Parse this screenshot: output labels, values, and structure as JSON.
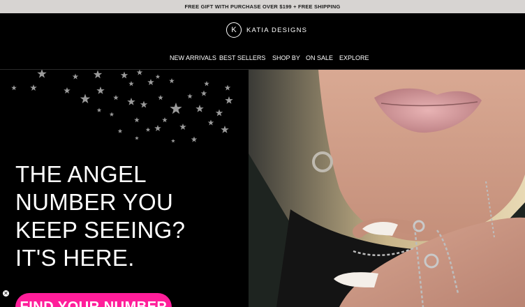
{
  "announcement": {
    "text": "FREE GIFT WITH PURCHASE OVER $199 + FREE SHIPPING"
  },
  "brand": {
    "logo_letter": "K",
    "name": "KATIA DESIGNS"
  },
  "nav": {
    "items": [
      {
        "label": "NEW ARRIVALS"
      },
      {
        "label": "BEST SELLERS"
      },
      {
        "label": "SHOP BY"
      },
      {
        "label": "ON SALE"
      },
      {
        "label": "EXPLORE"
      }
    ]
  },
  "hero": {
    "headline_lines": [
      "THE ANGEL",
      "NUMBER YOU",
      "KEEP SEEING?",
      "IT'S HERE."
    ],
    "cta_label": "FIND YOUR NUMBER",
    "close_glyph": "✕"
  },
  "colors": {
    "cta": "#ff1e9a",
    "announcement_bg": "#d7d4d2",
    "page_bg": "#000000"
  }
}
